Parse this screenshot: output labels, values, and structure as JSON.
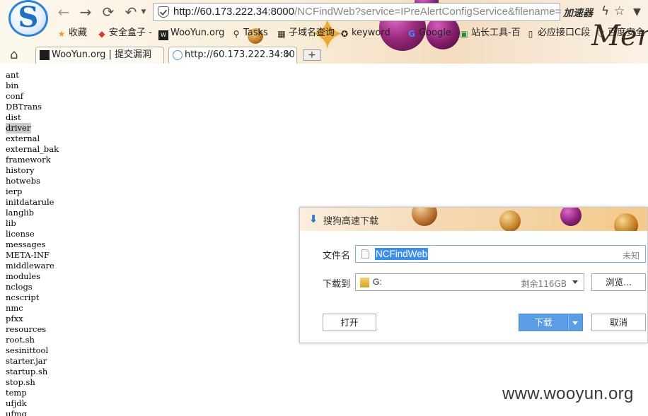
{
  "browser": {
    "address_host": "http://60.173.222.34:8000",
    "address_path": "/NCFindWeb?service=IPreAlertConfigService&filename=",
    "accelerator_label": "加速器",
    "bookmarks": [
      {
        "label": "收藏",
        "icon": "star-icon"
      },
      {
        "label": "安全盒子 -",
        "icon": "boxing-icon"
      },
      {
        "label": "WooYun.org",
        "icon": "wooyun-icon"
      },
      {
        "label": "Tasks",
        "icon": "search-icon"
      },
      {
        "label": "子域名查询",
        "icon": "grid-icon"
      },
      {
        "label": "keyword",
        "icon": "fox-icon"
      },
      {
        "label": "Google",
        "icon": "google-icon"
      },
      {
        "label": "站长工具-百",
        "icon": "webmaster-icon"
      },
      {
        "label": "必应接口C段",
        "icon": "doc-icon"
      },
      {
        "label": "百度安全",
        "icon": "shield-icon"
      }
    ],
    "tabs": [
      {
        "label": "WooYun.org | 提交漏洞",
        "icon": "wooyun-icon",
        "active": false
      },
      {
        "label": "http://60.173.222.34:80",
        "icon": "page-icon",
        "active": true
      }
    ],
    "new_tab_label": "+"
  },
  "listing": [
    "ant",
    "bin",
    "conf",
    "DBTrans",
    "dist",
    "driver",
    "external",
    "external_bak",
    "framework",
    "history",
    "hotwebs",
    "ierp",
    "initdatarule",
    "langlib",
    "lib",
    "license",
    "messages",
    "META-INF",
    "middleware",
    "modules",
    "nclogs",
    "ncscript",
    "nmc",
    "pfxx",
    "resources",
    "root.sh",
    "sesinittool",
    "starter.jar",
    "startup.sh",
    "stop.sh",
    "temp",
    "ufjdk",
    "ufmq"
  ],
  "selected_item": "driver",
  "dialog": {
    "title": "搜狗高速下载",
    "filename_label": "文件名",
    "filename_value": "NCFindWeb",
    "filesize": "未知",
    "saveto_label": "下载到",
    "saveto_value": "G:",
    "free_space": "剩余116GB",
    "browse_button": "浏览...",
    "open_button": "打开",
    "download_button": "下载",
    "cancel_button": "取消"
  },
  "watermark": "www.wooyun.org"
}
